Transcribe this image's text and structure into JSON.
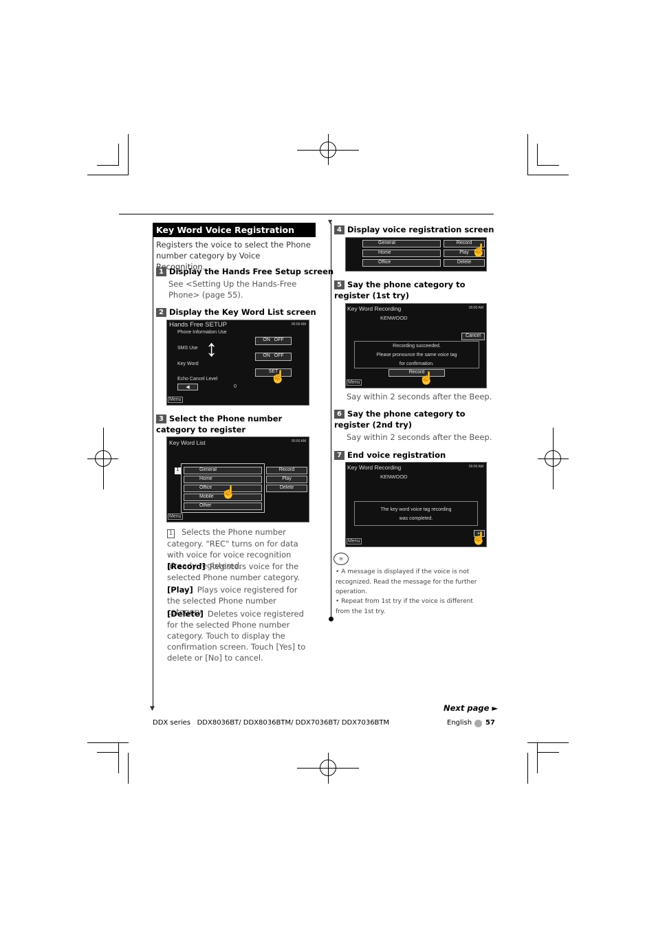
{
  "section_title": "Key Word Voice Registration",
  "intro": "Registers the voice to select the Phone number category by Voice Recognition.",
  "steps": [
    {
      "num": "1",
      "title": "Display the Hands Free Setup screen",
      "text": "See <Setting Up the Hands-Free Phone> (page 55)."
    },
    {
      "num": "2",
      "title": "Display the Key Word List screen"
    },
    {
      "num": "3",
      "title": "Select the Phone number category to register"
    },
    {
      "num": "4",
      "title": "Display voice registration screen"
    },
    {
      "num": "5",
      "title": "Say the phone category to register (1st try)",
      "text": "Say within 2 seconds after the Beep."
    },
    {
      "num": "6",
      "title": "Say the phone category to register (2nd try)",
      "text": "Say within 2 seconds after the Beep."
    },
    {
      "num": "7",
      "title": "End voice registration"
    }
  ],
  "screens": {
    "hf": {
      "title": "Hands Free SETUP",
      "rows": [
        "Phone Information Use",
        "SMS Use",
        "Key Word",
        "Echo Cancel Level"
      ],
      "on": "ON",
      "off": "OFF",
      "set": "SET",
      "value": "0",
      "menu": "Menu"
    },
    "kwl": {
      "title": "Key Word List",
      "items": [
        "General",
        "Home",
        "Office",
        "Mobile",
        "Other"
      ],
      "buttons": [
        "Record",
        "Play",
        "Delete"
      ],
      "marker": "1",
      "menu": "Menu"
    },
    "reg": {
      "items": [
        "General",
        "Home",
        "Office"
      ],
      "buttons": [
        "Record",
        "Play",
        "Delete"
      ]
    },
    "rec1": {
      "title": "Key Word Recording",
      "name": "KENWOOD",
      "cancel": "Cancel",
      "msg": [
        "Recording succeeded.",
        "Please pronounce the same voice tag",
        "for confirmation."
      ],
      "record": "Record",
      "menu": "Menu"
    },
    "rec2": {
      "title": "Key Word Recording",
      "name": "KENWOOD",
      "msg": [
        "The key word voice tag recording",
        "was completed."
      ],
      "menu": "Menu"
    },
    "status": "00:00 AM"
  },
  "descriptions": [
    {
      "key": "1",
      "text": "Selects the Phone number category. \"REC\" turns on for data with voice for voice recognition already registered."
    },
    {
      "key": "[Record]",
      "text": "Registers voice for the selected Phone number category."
    },
    {
      "key": "[Play]",
      "text": "Plays voice registered for the selected Phone number category."
    },
    {
      "key": "[Delete]",
      "text": "Deletes voice registered for the selected Phone number category. Touch to display the confirmation screen. Touch [Yes] to delete or [No] to cancel."
    }
  ],
  "notes": [
    "A message is displayed if the voice is not recognized. Read the message for the further operation.",
    "Repeat from 1st try if the voice is different from the 1st try."
  ],
  "next_page": "Next page ►",
  "footer": {
    "series": "DDX series   DDX8036BT/ DDX8036BTM/ DDX7036BT/ DDX7036BTM",
    "language": "English",
    "page": "57"
  }
}
